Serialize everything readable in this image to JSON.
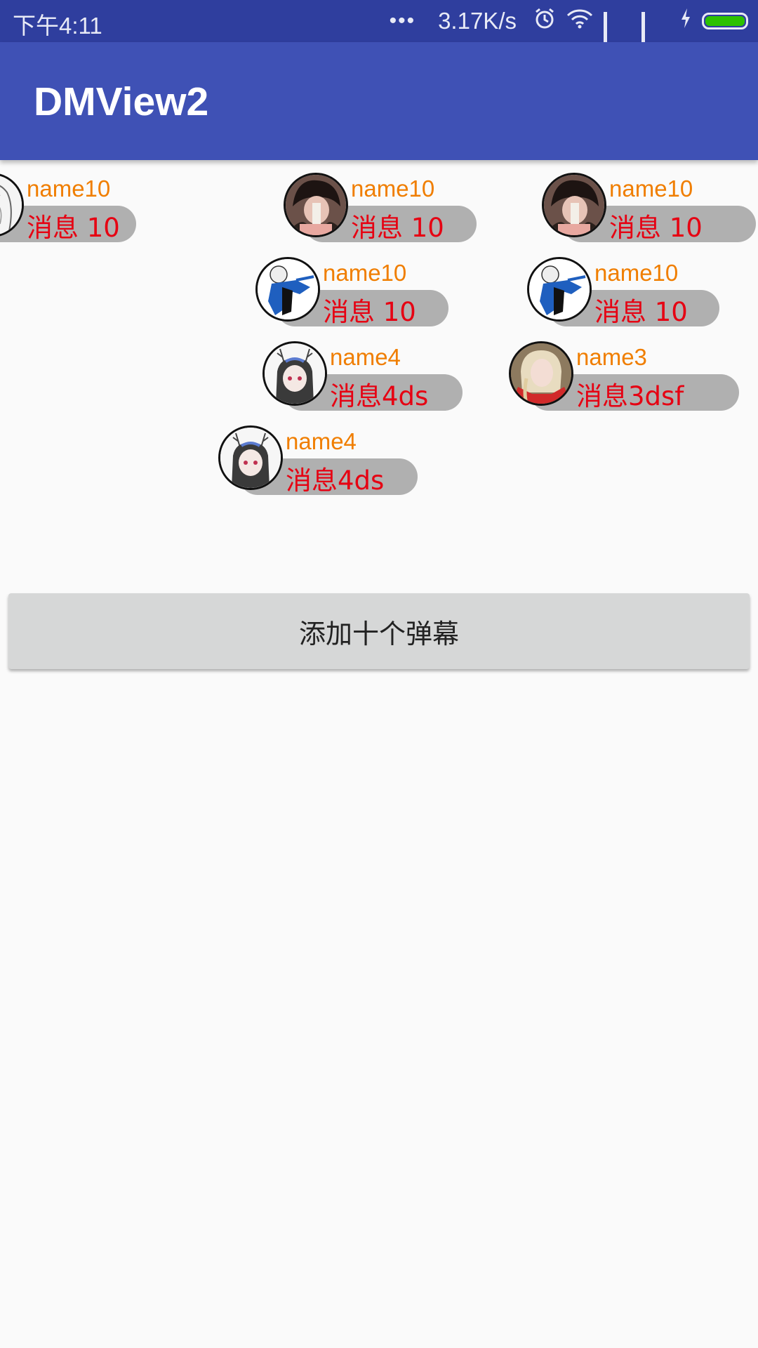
{
  "status_bar": {
    "time": "下午4:11",
    "ellipsis": "•••",
    "network_speed": "3.17K/s",
    "icons": [
      "ellipsis-icon",
      "alarm-icon",
      "wifi-icon",
      "signal-icon",
      "signal-icon",
      "charging-icon",
      "battery-icon"
    ],
    "battery_color": "#2cc100"
  },
  "app_bar": {
    "title": "DMView2",
    "color": "#3f51b5"
  },
  "danmaku": [
    {
      "name": "name10",
      "message": "消息 10",
      "avatar": "sketch-girl-avatar"
    },
    {
      "name": "name10",
      "message": "消息 10",
      "avatar": "dark-hair-avatar"
    },
    {
      "name": "name10",
      "message": "消息 10",
      "avatar": "dark-hair-avatar"
    },
    {
      "name": "name10",
      "message": "消息 10",
      "avatar": "blue-character-avatar"
    },
    {
      "name": "name10",
      "message": "消息 10",
      "avatar": "blue-character-avatar"
    },
    {
      "name": "name4",
      "message": "消息4ds",
      "avatar": "antler-girl-avatar"
    },
    {
      "name": "name3",
      "message": "消息3dsf",
      "avatar": "blonde-woman-avatar"
    },
    {
      "name": "name4",
      "message": "消息4ds",
      "avatar": "antler-girl-avatar"
    }
  ],
  "colors": {
    "name_text": "#f07e00",
    "message_text": "#e60012",
    "bubble": "#b0b0b0"
  },
  "button": {
    "label": "添加十个弹幕"
  }
}
